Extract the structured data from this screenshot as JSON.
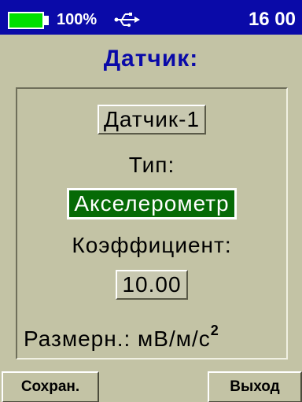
{
  "status_bar": {
    "battery_percent_text": "100%",
    "battery_level": 1.0,
    "usb_icon": "usb-icon",
    "time": "16 00"
  },
  "heading": "Датчик:",
  "sensor": {
    "name_value": "Датчик-1",
    "type_label": "Тип:",
    "type_value": "Акселерометр",
    "coefficient_label": "Коэффициент:",
    "coefficient_value": "10.00",
    "units_label": "Размерн.:",
    "units_value": "мВ/м/с",
    "units_superscript": "2"
  },
  "buttons": {
    "save_label": "Сохран.",
    "exit_label": "Выход"
  },
  "colors": {
    "status_bar_bg": "#0a0aa8",
    "screen_bg": "#c3c3a5",
    "battery_fill": "#00e000",
    "heading_text": "#0a0aa8",
    "selected_field_bg": "#066a06"
  }
}
